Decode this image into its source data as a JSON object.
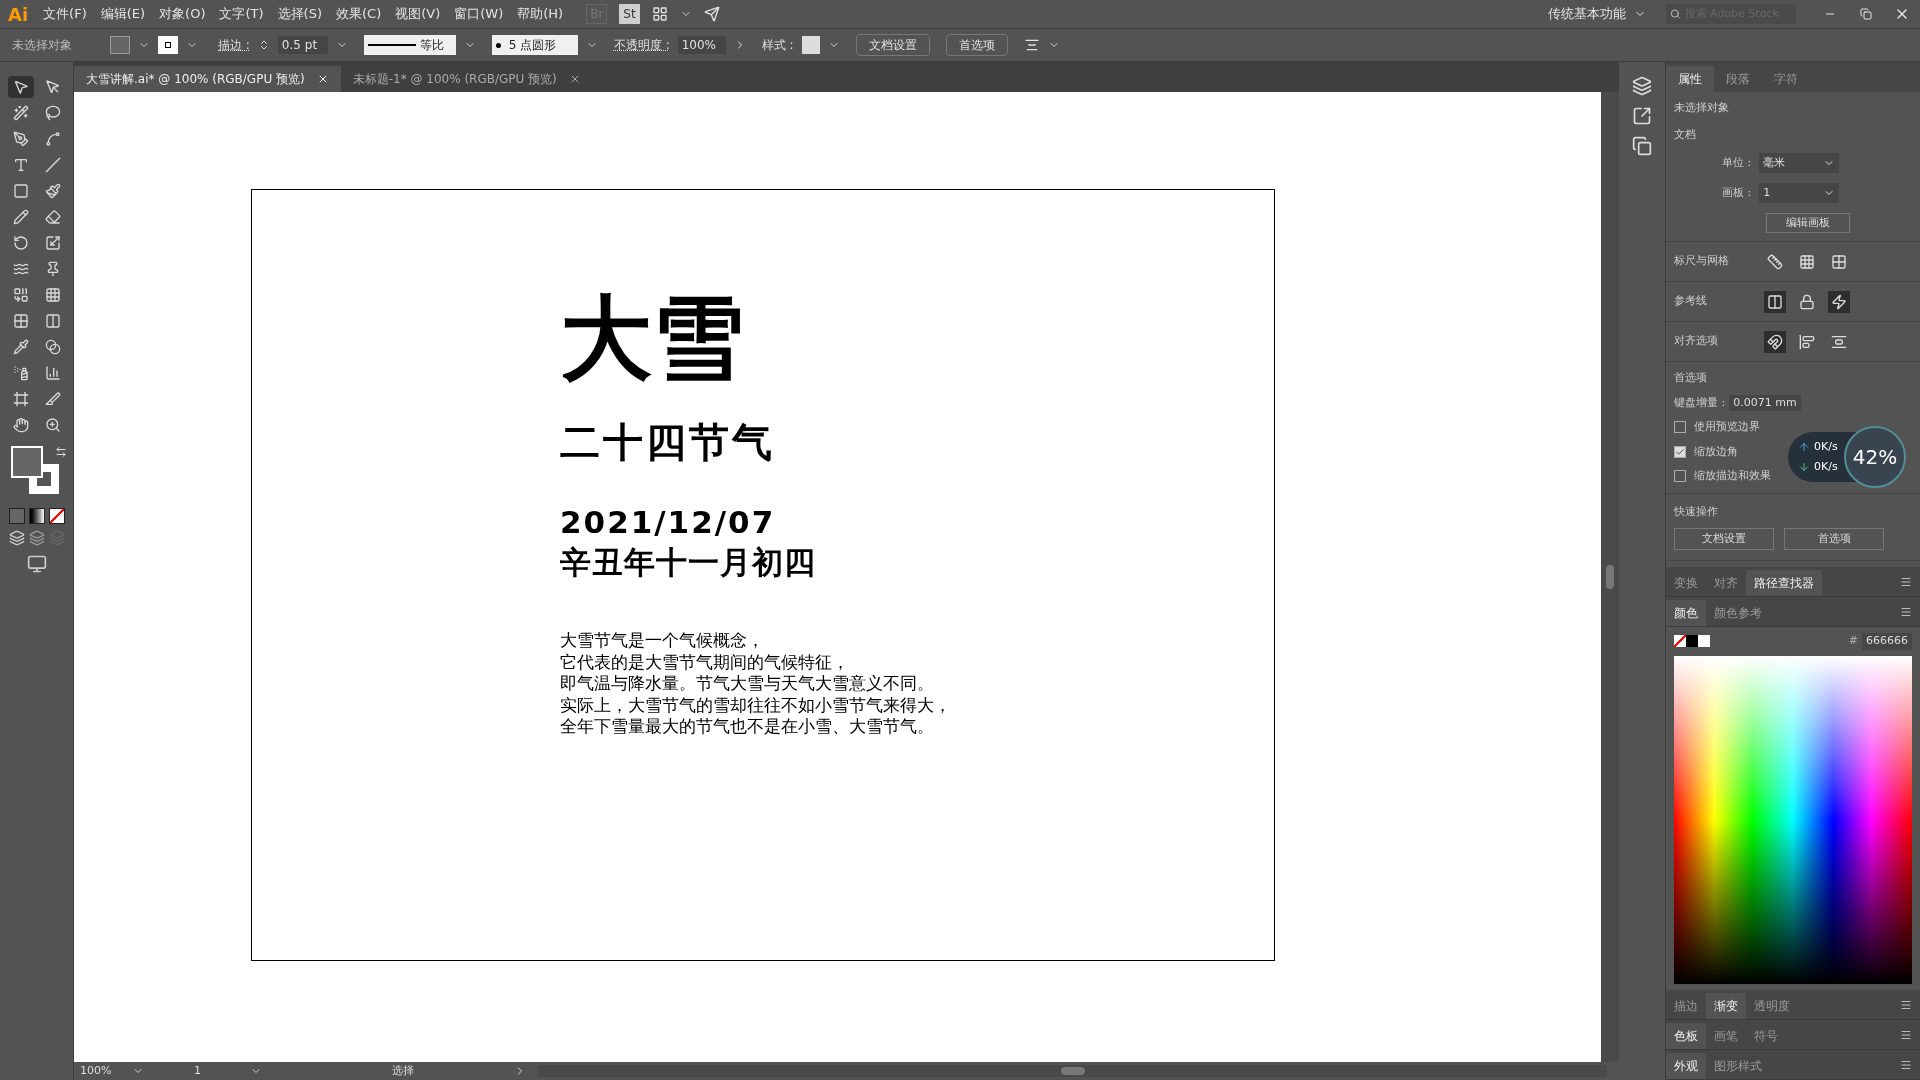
{
  "menu_bar": {
    "logo": "Ai",
    "items": [
      "文件(F)",
      "编辑(E)",
      "对象(O)",
      "文字(T)",
      "选择(S)",
      "效果(C)",
      "视图(V)",
      "窗口(W)",
      "帮助(H)"
    ],
    "app_icons": [
      {
        "label": "Br",
        "disabled": true
      },
      {
        "label": "St",
        "disabled": false
      }
    ],
    "workspace": "传统基本功能",
    "search": {
      "placeholder": "搜索 Adobe Stock"
    }
  },
  "control_bar": {
    "selection": "未选择对象",
    "stroke_label": "描边 :",
    "stroke_value": "0.5 pt",
    "line_profile": "等比",
    "brush": "5 点圆形",
    "opacity_label": "不透明度 :",
    "opacity_value": "100%",
    "style_label": "样式 :",
    "buttons": [
      "文档设置",
      "首选项"
    ]
  },
  "document_tabs": [
    {
      "title": "大雪讲解.ai* @ 100% (RGB/GPU 预览)",
      "selected": true
    },
    {
      "title": "未标题-1* @ 100% (RGB/GPU 预览)",
      "selected": false
    }
  ],
  "tools": [
    {
      "kind": "select",
      "selected": true
    },
    {
      "kind": "direct",
      "selected": false
    },
    {
      "kind": "wand",
      "selected": false
    },
    {
      "kind": "lasso",
      "selected": false
    },
    {
      "kind": "pen",
      "selected": false
    },
    {
      "kind": "curvature",
      "selected": false
    },
    {
      "kind": "type",
      "selected": false
    },
    {
      "kind": "line",
      "selected": false
    },
    {
      "kind": "rectangle",
      "selected": false
    },
    {
      "kind": "brush",
      "selected": false
    },
    {
      "kind": "shaper",
      "selected": false
    },
    {
      "kind": "eraser",
      "selected": false
    },
    {
      "kind": "rotate",
      "selected": false
    },
    {
      "kind": "scale",
      "selected": false
    },
    {
      "kind": "warp",
      "selected": false
    },
    {
      "kind": "pin",
      "selected": false
    },
    {
      "kind": "builder",
      "selected": false
    },
    {
      "kind": "perspective",
      "selected": false
    },
    {
      "kind": "mesh",
      "selected": false
    },
    {
      "kind": "gradient",
      "selected": false
    },
    {
      "kind": "eyedropper",
      "selected": false
    },
    {
      "kind": "blend",
      "selected": false
    },
    {
      "kind": "spray",
      "selected": false
    },
    {
      "kind": "chart",
      "selected": false
    },
    {
      "kind": "artboard",
      "selected": false
    },
    {
      "kind": "slice",
      "selected": false
    },
    {
      "kind": "hand",
      "selected": false
    },
    {
      "kind": "zoom",
      "selected": false
    }
  ],
  "artboard": {
    "title": "大雪",
    "subtitle": "二十四节气",
    "date": "2021/12/07",
    "lunar_date": "辛丑年十一月初四",
    "paragraph": [
      "大雪节气是一个气候概念，",
      "它代表的是大雪节气期间的气候特征，",
      "即气温与降水量。节气大雪与天气大雪意义不同。",
      "实际上，大雪节气的雪却往往不如小雪节气来得大，",
      "全年下雪量最大的节气也不是在小雪、大雪节气。"
    ]
  },
  "status_bar": {
    "zoom": "100%",
    "artboard": "1",
    "tool": "选择"
  },
  "properties_panel": {
    "tabs": [
      {
        "label": "属性",
        "selected": true
      },
      {
        "label": "段落",
        "selected": false
      },
      {
        "label": "字符",
        "selected": false
      }
    ],
    "selection": "未选择对象",
    "document_heading": "文档",
    "unit_label": "单位 :",
    "unit_value": "毫米",
    "artboard_label": "画板 :",
    "artboard_value": "1",
    "edit_artboard": "编辑画板",
    "icon_rows": [
      {
        "label": "标尺与网格",
        "icons": [
          {
            "kind": "ruler",
            "on": false
          },
          {
            "kind": "grid",
            "on": false
          },
          {
            "kind": "transparency",
            "on": false
          }
        ]
      },
      {
        "label": "参考线",
        "icons": [
          {
            "kind": "guides",
            "on": true
          },
          {
            "kind": "lock",
            "on": false
          },
          {
            "kind": "smart",
            "on": true
          }
        ]
      },
      {
        "label": "对齐选项",
        "icons": [
          {
            "kind": "point",
            "on": true
          },
          {
            "kind": "pixel",
            "on": false
          },
          {
            "kind": "glyph",
            "on": false
          }
        ]
      }
    ],
    "preferences_heading": "首选项",
    "keyboard_label": "键盘增量 :",
    "keyboard_value": "0.0071 mm",
    "checkboxes": [
      {
        "label": "使用预览边界",
        "checked": false
      },
      {
        "label": "缩放边角",
        "checked": true
      },
      {
        "label": "缩放描边和效果",
        "checked": false
      }
    ],
    "quick_heading": "快速操作",
    "quick_buttons": [
      "文档设置",
      "首选项"
    ]
  },
  "panel_groups": [
    {
      "tabs": [
        {
          "label": "变换",
          "selected": false
        },
        {
          "label": "对齐",
          "selected": false
        },
        {
          "label": "路径查找器",
          "selected": true
        }
      ]
    },
    {
      "tabs": [
        {
          "label": "颜色",
          "selected": true
        },
        {
          "label": "颜色参考",
          "selected": false
        }
      ],
      "hex_label": "#",
      "hex_value": "666666"
    },
    {
      "tabs": [
        {
          "label": "描边",
          "selected": false
        },
        {
          "label": "渐变",
          "selected": true
        },
        {
          "label": "透明度",
          "selected": false
        }
      ]
    },
    {
      "tabs": [
        {
          "label": "色板",
          "selected": true
        },
        {
          "label": "画笔",
          "selected": false
        },
        {
          "label": "符号",
          "selected": false
        }
      ]
    },
    {
      "tabs": [
        {
          "label": "外观",
          "selected": true
        },
        {
          "label": "图形样式",
          "selected": false
        }
      ]
    }
  ],
  "network_meter": {
    "upload": "0K/s",
    "download": "0K/s",
    "percent": "42%"
  }
}
